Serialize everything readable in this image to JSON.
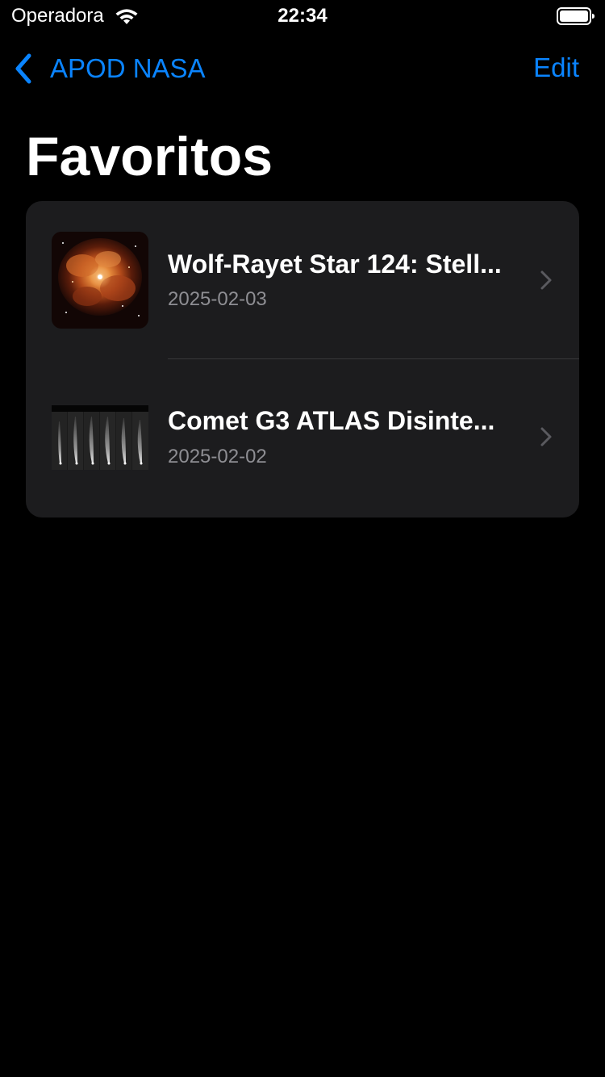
{
  "status_bar": {
    "carrier": "Operadora",
    "time": "22:34",
    "wifi_icon": "wifi-icon",
    "battery_icon": "battery-icon"
  },
  "nav": {
    "back_label": "APOD NASA",
    "back_icon": "chevron-left-icon",
    "edit_label": "Edit",
    "accent_color": "#0a84ff"
  },
  "page": {
    "title": "Favoritos"
  },
  "favorites": [
    {
      "title": "Wolf-Rayet Star 124: Stell...",
      "date": "2025-02-03",
      "thumbnail_icon": "nebula-thumbnail"
    },
    {
      "title": "Comet G3 ATLAS Disinte...",
      "date": "2025-02-02",
      "thumbnail_icon": "comet-sequence-thumbnail"
    }
  ],
  "colors": {
    "background": "#000000",
    "card": "#1c1c1e",
    "secondary_text": "#8e8e93",
    "separator": "#38383a"
  }
}
